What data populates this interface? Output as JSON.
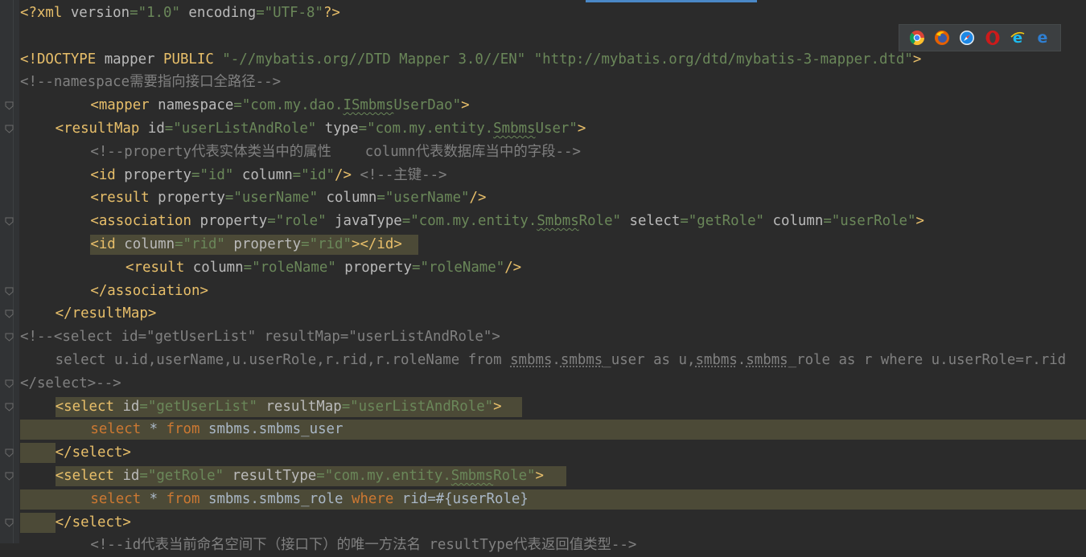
{
  "editor": {
    "lines": [
      {
        "indent": 0,
        "segments": [
          [
            "tag",
            "<?xml "
          ],
          [
            "attr",
            "version"
          ],
          [
            "val",
            "=\"1.0\""
          ],
          [
            "attr",
            " encoding"
          ],
          [
            "val",
            "=\"UTF-8\""
          ],
          [
            "tag",
            "?>"
          ]
        ]
      },
      {
        "indent": 0,
        "segments": []
      },
      {
        "indent": 0,
        "segments": [
          [
            "tag",
            "<!DOCTYPE "
          ],
          [
            "attr",
            "mapper "
          ],
          [
            "tag",
            "PUBLIC "
          ],
          [
            "val",
            "\"-//mybatis.org//DTD Mapper 3.0//EN\" "
          ],
          [
            "val",
            "\"http://mybatis.org/dtd/mybatis-3-mapper.dtd\""
          ],
          [
            "tag",
            ">"
          ]
        ]
      },
      {
        "indent": 0,
        "segments": [
          [
            "cmt",
            "<!--namespace需要指向接口全路径-->"
          ]
        ]
      },
      {
        "indent": 8,
        "segments": [
          [
            "tag",
            "<mapper "
          ],
          [
            "attr",
            "namespace"
          ],
          [
            "val",
            "=\"com.my.dao."
          ],
          [
            "valtypo",
            "ISmbms"
          ],
          [
            "val",
            "UserDao\""
          ],
          [
            "tag",
            ">"
          ]
        ]
      },
      {
        "indent": 4,
        "segments": [
          [
            "tag",
            "<resultMap "
          ],
          [
            "attr",
            "id"
          ],
          [
            "val",
            "=\"userListAndRole\""
          ],
          [
            "attr",
            " type"
          ],
          [
            "val",
            "=\"com.my.entity."
          ],
          [
            "valtypo",
            "Smbms"
          ],
          [
            "val",
            "User\""
          ],
          [
            "tag",
            ">"
          ]
        ]
      },
      {
        "indent": 8,
        "segments": [
          [
            "cmt",
            "<!--property代表实体类当中的属性    column代表数据库当中的字段-->"
          ]
        ]
      },
      {
        "indent": 8,
        "segments": [
          [
            "tag",
            "<id "
          ],
          [
            "attr",
            "property"
          ],
          [
            "val",
            "=\"id\""
          ],
          [
            "attr",
            " column"
          ],
          [
            "val",
            "=\"id\""
          ],
          [
            "tag",
            "/>"
          ],
          [
            "cmt",
            " <!--主键-->"
          ]
        ]
      },
      {
        "indent": 8,
        "segments": [
          [
            "tag",
            "<result "
          ],
          [
            "attr",
            "property"
          ],
          [
            "val",
            "=\"userName\""
          ],
          [
            "attr",
            " column"
          ],
          [
            "val",
            "=\"userName\""
          ],
          [
            "tag",
            "/>"
          ]
        ]
      },
      {
        "indent": 8,
        "segments": [
          [
            "tag",
            "<association "
          ],
          [
            "attr",
            "property"
          ],
          [
            "val",
            "=\"role\""
          ],
          [
            "attr",
            " javaType"
          ],
          [
            "val",
            "=\"com.my.entity."
          ],
          [
            "valtypo",
            "Smbms"
          ],
          [
            "val",
            "Role\""
          ],
          [
            "attr",
            " select"
          ],
          [
            "val",
            "=\"getRole\""
          ],
          [
            "attr",
            " column"
          ],
          [
            "val",
            "=\"userRole\""
          ],
          [
            "tag",
            ">"
          ]
        ]
      },
      {
        "indent": 8,
        "highlight": "tagline",
        "segments": [
          [
            "tag",
            "<id "
          ],
          [
            "attr",
            "column"
          ],
          [
            "val",
            "=\"rid\""
          ],
          [
            "attr",
            " property"
          ],
          [
            "val",
            "=\"rid\""
          ],
          [
            "tag",
            "></id>"
          ]
        ]
      },
      {
        "indent": 12,
        "segments": [
          [
            "tag",
            "<result "
          ],
          [
            "attr",
            "column"
          ],
          [
            "val",
            "=\"roleName\""
          ],
          [
            "attr",
            " property"
          ],
          [
            "val",
            "=\"roleName\""
          ],
          [
            "tag",
            "/>"
          ]
        ]
      },
      {
        "indent": 8,
        "segments": [
          [
            "tag",
            "</association>"
          ]
        ]
      },
      {
        "indent": 4,
        "segments": [
          [
            "tag",
            "</resultMap>"
          ]
        ]
      },
      {
        "indent": 0,
        "segments": [
          [
            "cmt",
            "<!--<select id=\"getUserList\" resultMap=\"userListAndRole\">"
          ]
        ]
      },
      {
        "indent": 4,
        "segments": [
          [
            "cmt",
            "select u.id,userName,u.userRole,r.rid,r.roleName from "
          ],
          [
            "cmttypo",
            "smbms"
          ],
          [
            "cmt",
            "."
          ],
          [
            "cmttypo",
            "smbms"
          ],
          [
            "cmt",
            "_user as u,"
          ],
          [
            "cmttypo",
            "smbms"
          ],
          [
            "cmt",
            "."
          ],
          [
            "cmttypo",
            "smbms"
          ],
          [
            "cmt",
            "_role as r where u.userRole=r.rid"
          ]
        ]
      },
      {
        "indent": 0,
        "segments": [
          [
            "cmt",
            "</select>-->"
          ]
        ]
      },
      {
        "indent": 4,
        "highlight": "select-open",
        "segments": [
          [
            "tag",
            "<select "
          ],
          [
            "attr",
            "id"
          ],
          [
            "val",
            "=\"getUserList\""
          ],
          [
            "attr",
            " resultMap"
          ],
          [
            "val",
            "=\"userListAndRole\""
          ],
          [
            "tag",
            ">"
          ]
        ]
      },
      {
        "indent": 8,
        "highlight": "select-body",
        "segments": [
          [
            "kw",
            "select"
          ],
          [
            "txt",
            " * "
          ],
          [
            "kw",
            "from"
          ],
          [
            "txt",
            " smbms.smbms_user"
          ]
        ]
      },
      {
        "indent": 4,
        "highlight": "select-close",
        "segments": [
          [
            "tag",
            "</select>"
          ]
        ]
      },
      {
        "indent": 4,
        "highlight": "select-open2",
        "segments": [
          [
            "tag",
            "<select "
          ],
          [
            "attr",
            "id"
          ],
          [
            "val",
            "=\"getRole\""
          ],
          [
            "attr",
            " resultType"
          ],
          [
            "val",
            "=\"com.my.entity."
          ],
          [
            "valtypo",
            "Smbms"
          ],
          [
            "val",
            "Role\""
          ],
          [
            "tag",
            ">"
          ]
        ]
      },
      {
        "indent": 8,
        "highlight": "select-body",
        "segments": [
          [
            "kw",
            "select"
          ],
          [
            "txt",
            " * "
          ],
          [
            "kw",
            "from"
          ],
          [
            "txt",
            " smbms.smbms_role "
          ],
          [
            "kw",
            "where"
          ],
          [
            "txt",
            " rid=#{userRole}"
          ]
        ]
      },
      {
        "indent": 4,
        "highlight": "select-close",
        "segments": [
          [
            "tag",
            "</select>"
          ]
        ]
      },
      {
        "indent": 8,
        "segments": [
          [
            "cmt",
            "<!--id代表当前命名空间下（接口下）的唯一方法名 resultType代表返回值类型-->"
          ]
        ]
      }
    ]
  },
  "browser_toolbar": {
    "icons": [
      "chrome-icon",
      "firefox-icon",
      "safari-icon",
      "opera-icon",
      "internet-explorer-icon",
      "edge-icon"
    ],
    "colors": {
      "chrome": "#db4437",
      "firefox": "#e66000",
      "safari": "#1e88e5",
      "opera": "#cc1b1b",
      "ie": "#1ebbee",
      "edge": "#2f7fd1"
    }
  },
  "colors": {
    "background": "#2b2b2b",
    "gutter": "#313335",
    "tag": "#e8bf6a",
    "attribute": "#bababa",
    "value": "#6a8759",
    "comment": "#808080",
    "keyword": "#cc7832",
    "text": "#a9b7c6",
    "highlight": "#4c4a37"
  }
}
